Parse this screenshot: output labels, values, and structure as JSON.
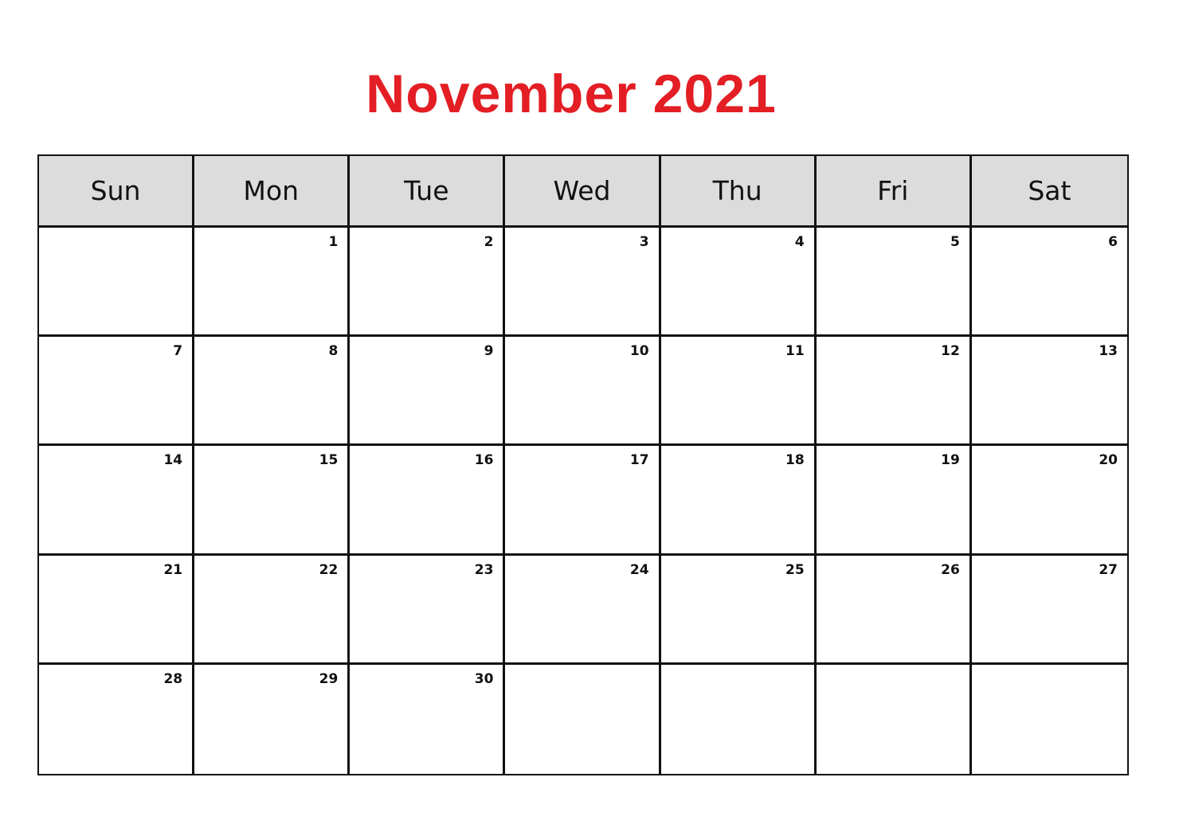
{
  "title": "November 2021",
  "colors": {
    "title": "#e31e24",
    "header_bg": "#dcdcdc",
    "grid": "#111111"
  },
  "weekdays": [
    "Sun",
    "Mon",
    "Tue",
    "Wed",
    "Thu",
    "Fri",
    "Sat"
  ],
  "weeks": [
    [
      "",
      "1",
      "2",
      "3",
      "4",
      "5",
      "6"
    ],
    [
      "7",
      "8",
      "9",
      "10",
      "11",
      "12",
      "13"
    ],
    [
      "14",
      "15",
      "16",
      "17",
      "18",
      "19",
      "20"
    ],
    [
      "21",
      "22",
      "23",
      "24",
      "25",
      "26",
      "27"
    ],
    [
      "28",
      "29",
      "30",
      "",
      "",
      "",
      ""
    ]
  ]
}
